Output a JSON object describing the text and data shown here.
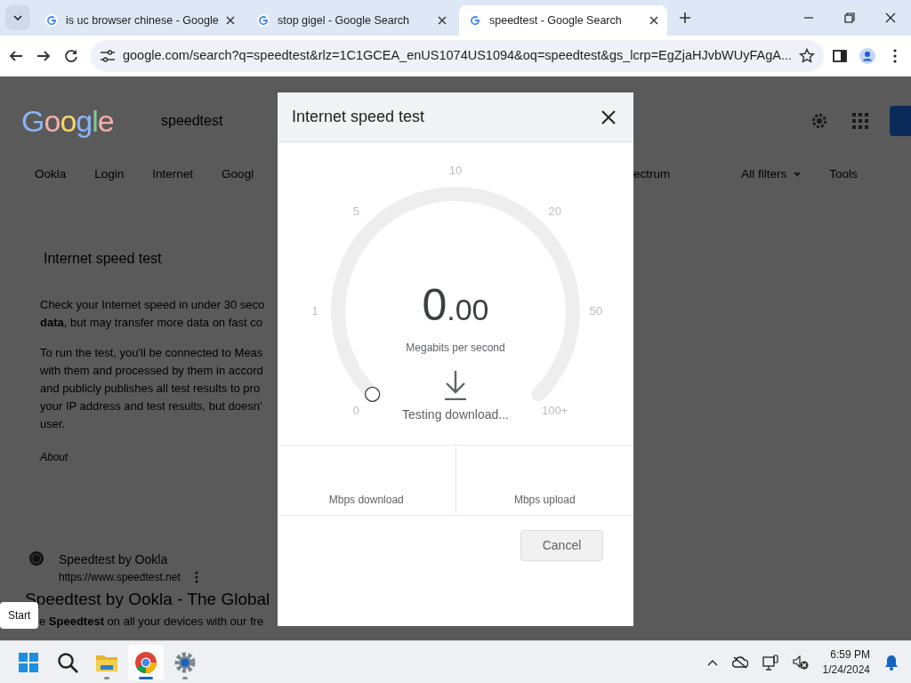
{
  "browser": {
    "tabs": [
      {
        "title": "is uc browser chinese - Google",
        "selected": false
      },
      {
        "title": "stop gigel - Google Search",
        "selected": false
      },
      {
        "title": "speedtest - Google Search",
        "selected": true
      }
    ],
    "address": "google.com/search?q=speedtest&rlz=1C1GCEA_enUS1074US1094&oq=speedtest&gs_lcrp=EgZjaHJvbWUyFAgA..."
  },
  "page": {
    "logo": "Google",
    "query": "speedtest",
    "chips": [
      "Ookla",
      "Login",
      "Internet",
      "Googl"
    ],
    "chip_tail": "ectrum",
    "filters": "All filters",
    "tools": "Tools",
    "card_title": "Internet speed test",
    "paragraphs": [
      [
        "Check your Internet speed in under 30 seco",
        "**data**, but may transfer more data on fast co"
      ],
      [
        "To run the test, you'll be connected to Meas",
        "with them and processed by them in accord",
        "and publicly publishes all test results to pro",
        "your IP address and test results, but doesn'",
        "user."
      ]
    ],
    "about": "About",
    "result": {
      "site": "Speedtest by Ookla",
      "url": "https://www.speedtest.net",
      "title": "Speedtest by Ookla - The Global",
      "snippet": "e **Speedtest** on all your devices with our fre"
    }
  },
  "dialog": {
    "title": "Internet speed test",
    "ticks": [
      "0",
      "1",
      "5",
      "10",
      "20",
      "50",
      "100+"
    ],
    "reading_whole": "0",
    "reading_fraction": ".00",
    "unit": "Megabits per second",
    "status": "Testing download...",
    "stats": [
      "Mbps download",
      "Mbps upload"
    ],
    "cancel": "Cancel"
  },
  "tooltip": "Start",
  "taskbar": {
    "apps": [
      {
        "kind": "start",
        "running": false,
        "selected": false
      },
      {
        "kind": "search",
        "running": false,
        "selected": false
      },
      {
        "kind": "files",
        "running": true,
        "selected": false
      },
      {
        "kind": "chrome",
        "running": true,
        "selected": true
      },
      {
        "kind": "settings",
        "running": true,
        "selected": false
      }
    ],
    "time": "6:59 PM",
    "date": "1/24/2024"
  }
}
